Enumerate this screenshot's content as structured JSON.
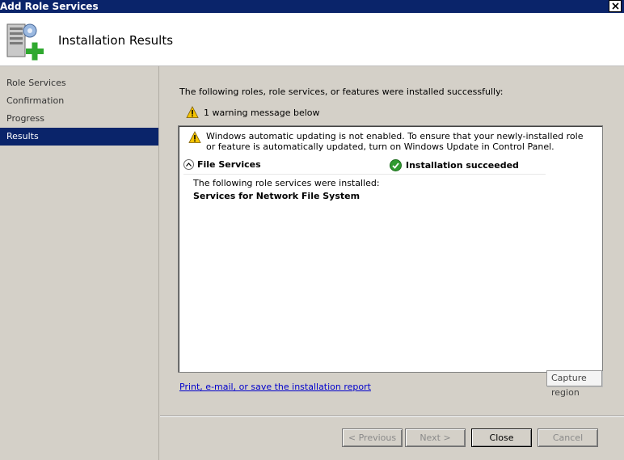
{
  "window": {
    "title": "Add Role Services"
  },
  "header": {
    "title": "Installation Results"
  },
  "sidebar": {
    "items": [
      {
        "label": "Role Services"
      },
      {
        "label": "Confirmation"
      },
      {
        "label": "Progress"
      },
      {
        "label": "Results",
        "active": true
      }
    ]
  },
  "main": {
    "intro": "The following roles, role services, or features were installed successfully:",
    "warning_summary": "1 warning message below",
    "results": {
      "warning_text": "Windows automatic updating is not enabled. To ensure that your newly-installed role or feature is automatically updated, turn on Windows Update in Control Panel.",
      "role_name": "File Services",
      "status": "Installation succeeded",
      "installed_intro": "The following role services were installed:",
      "installed_service": "Services for Network File System"
    },
    "tooltip": "Capture region",
    "report_link": "Print, e-mail, or save the installation report"
  },
  "buttons": {
    "previous": "< Previous",
    "next": "Next >",
    "close": "Close",
    "cancel": "Cancel"
  },
  "colors": {
    "titlebar": "#0a246a",
    "selection": "#0a246a",
    "link": "#0000cc",
    "success": "#2f9a2f",
    "warning": "#f5c400"
  },
  "icons": {
    "window_close": "close-icon",
    "header": "server-add-icon",
    "warning": "warning-icon",
    "success": "check-circle-icon",
    "collapse": "chevron-up-icon"
  }
}
